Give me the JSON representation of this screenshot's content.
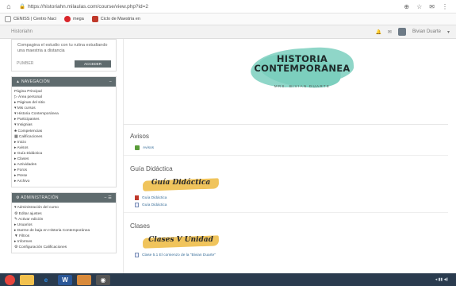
{
  "browser": {
    "url": "https://historiahn.milaulas.com/course/view.php?id=2",
    "bookmarks": [
      {
        "label": "CENISS | Centro Naci",
        "color": "#ffffff"
      },
      {
        "label": "mega",
        "color": "#d9262b"
      },
      {
        "label": "Ciclo de Maestria en",
        "color": "#c0392b"
      }
    ]
  },
  "navbar": {
    "site_name": "Historiahn",
    "user_name": "Bivian Duarte"
  },
  "left": {
    "promo_text": "Compagina el estudio con tu rutina estudiando una maestria a distancia",
    "login_label": "PUMBER",
    "login_button": "ACCEDER",
    "navigation": {
      "title": "NAVEGACIÓN",
      "items": [
        "Página Principal",
        "▷ Área personal",
        "▸ Páginas del sitio",
        "▾ Mis cursos",
        "  ▾ Historia Contemporánea",
        "     ▸ Participantes",
        "     ▾ Insignias",
        "     ♣ Competencias",
        "     ▦ Calificaciones",
        "     ▸ Inicio",
        "     ▸ Avisos",
        "     ▸ Guía Didáctica",
        "     ▸ Clases",
        "     ▸ Actividades",
        "     ▸ Foros",
        "     ▸ Prese",
        "     ▸ Archivo"
      ]
    },
    "admin": {
      "title": "ADMINISTRACIÓN",
      "items": [
        "▾ Administración del curso",
        "   ⚙ Editar ajustes",
        "   ✎ Activar edición",
        "   ▸ Usuarios",
        "   ▸ Darme de baja en Historia Contemporánea",
        "   ▼ Filtros",
        "   ▸ Informes",
        "   ⚙ Configuración Calificaciones"
      ]
    }
  },
  "banner": {
    "title_line1": "HISTORIA",
    "title_line2": "CONTEMPORANEA",
    "subtitle": "MRS. BIVIAN DUARTE"
  },
  "sections": {
    "avisos": {
      "title": "Avisos",
      "item": "Avisos"
    },
    "guia": {
      "title": "Guía Didáctica",
      "ribbon": "Guía Didáctica",
      "items": [
        "Guía Didáctica",
        "Guía Didáctica"
      ]
    },
    "clases": {
      "title": "Clases",
      "ribbon": "Clases V Unidad",
      "item": "Clase 5.1 El comienzo de la \"Bivian Duarte\""
    }
  },
  "taskbar": {
    "apps": [
      {
        "name": "chrome",
        "color": "#e8453c"
      },
      {
        "name": "explorer",
        "color": "#f2c14e"
      },
      {
        "name": "ie",
        "color": "#2b8be8"
      },
      {
        "name": "word",
        "color": "#2b5797"
      },
      {
        "name": "media",
        "color": "#d98a3b"
      },
      {
        "name": "camera",
        "color": "#555555"
      }
    ]
  }
}
